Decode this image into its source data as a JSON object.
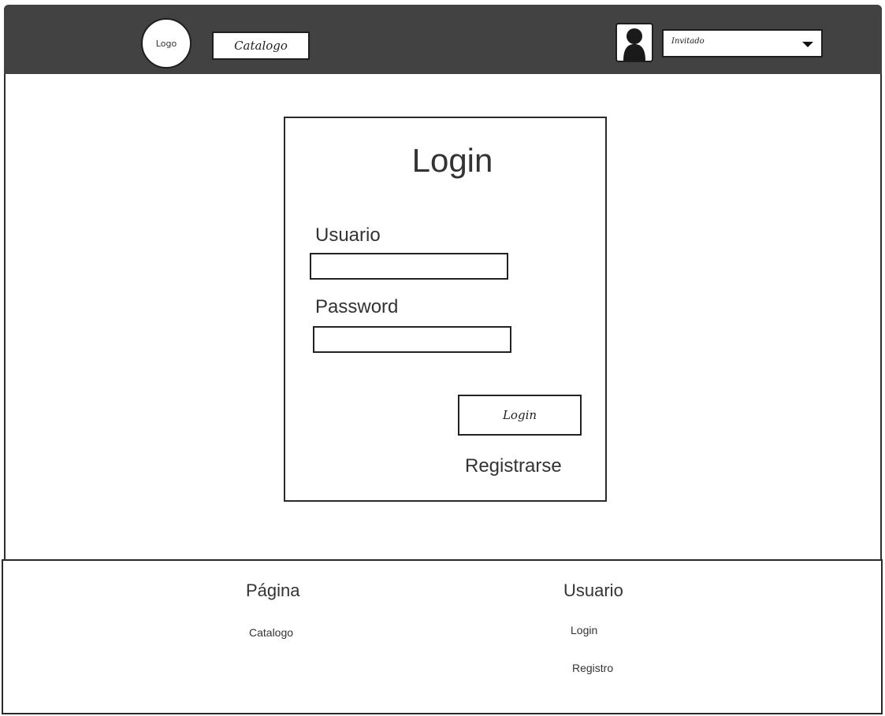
{
  "header": {
    "logo_text": "Logo",
    "nav_catalogo": "Catalogo",
    "user_select_value": "Invitado"
  },
  "login": {
    "title": "Login",
    "usuario_label": "Usuario",
    "password_label": "Password",
    "usuario_value": "",
    "password_value": "",
    "button_label": "Login",
    "register_link": "Registrarse"
  },
  "footer": {
    "col1_title": "Página",
    "col1_links": [
      "Catalogo"
    ],
    "col2_title": "Usuario",
    "col2_links": [
      "Login",
      "Registro"
    ]
  },
  "colors": {
    "header_bg": "#424242",
    "border": "#222222",
    "text": "#333333"
  },
  "icons": {
    "avatar": "user-silhouette-icon",
    "dropdown": "caret-down-icon"
  }
}
